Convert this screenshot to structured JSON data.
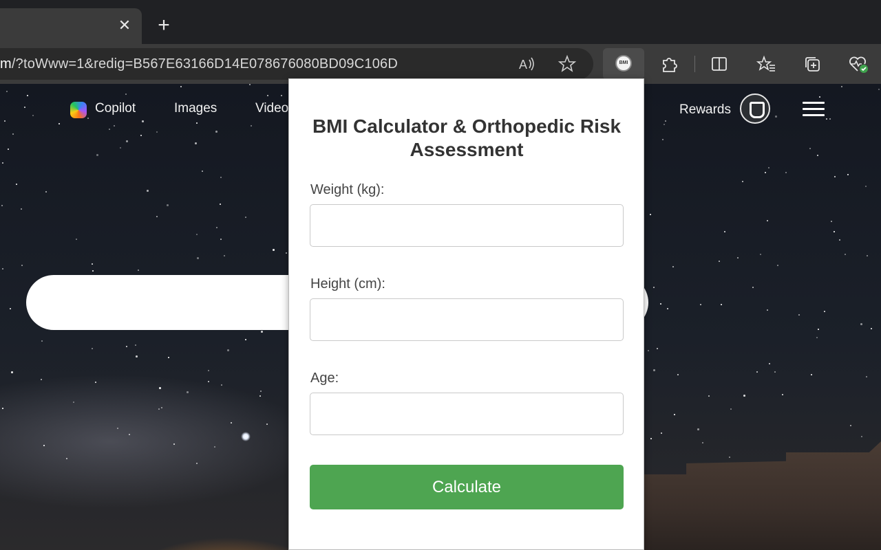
{
  "browser": {
    "address": {
      "host_fragment": "m",
      "path": "/?toWww=1&redig=B567E63166D14E078676080BD09C106D"
    },
    "tab_close_glyph": "✕",
    "new_tab_glyph": "+",
    "icons": {
      "read_aloud": "read-aloud-icon",
      "favorite": "star-icon",
      "bmi_extension": "bmi-extension-icon",
      "extensions": "puzzle-icon",
      "split_screen": "split-screen-icon",
      "favorites": "favorites-list-icon",
      "collections": "collections-icon",
      "browser_essentials": "heart-pulse-icon"
    },
    "bmi_badge_text": "BMI"
  },
  "bing": {
    "nav": [
      {
        "label": "Copilot"
      },
      {
        "label": "Images"
      },
      {
        "label": "Video"
      }
    ],
    "rewards_label": "Rewards"
  },
  "popup": {
    "title": "BMI Calculator & Orthopedic Risk Assessment",
    "fields": [
      {
        "label": "Weight (kg):",
        "value": "",
        "placeholder": ""
      },
      {
        "label": "Height (cm):",
        "value": "",
        "placeholder": ""
      },
      {
        "label": "Age:",
        "value": "",
        "placeholder": ""
      }
    ],
    "button_label": "Calculate",
    "accent_color": "#4ea551"
  }
}
